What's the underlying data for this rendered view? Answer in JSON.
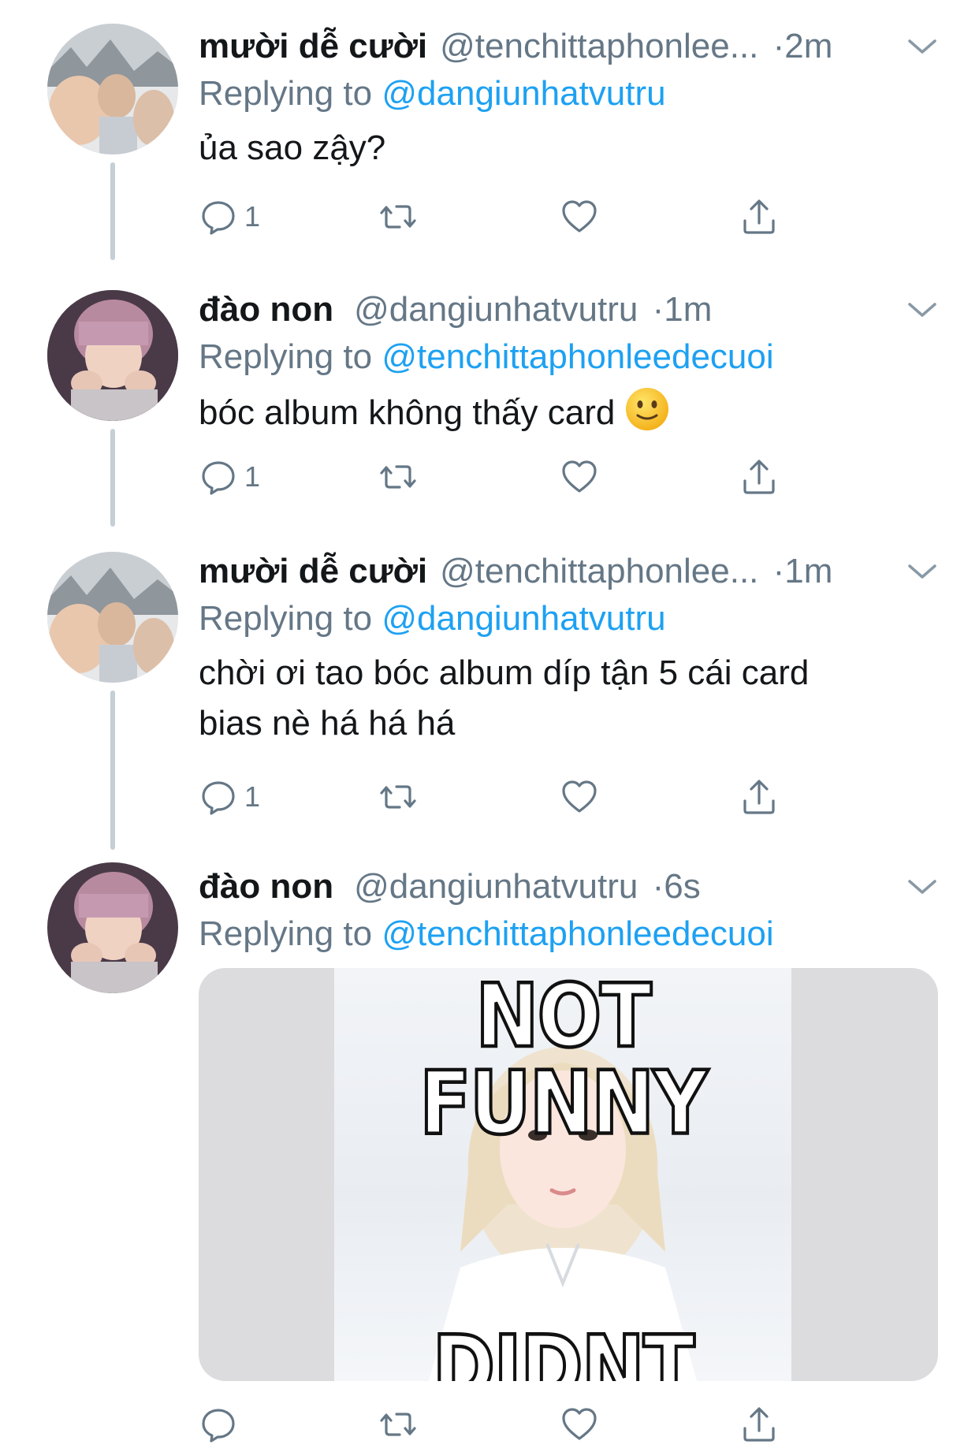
{
  "colors": {
    "link": "#1da1f2",
    "secondary": "#657786",
    "thread_line": "#c4cfd6"
  },
  "tweets": [
    {
      "display_name": "mười dễ cười",
      "handle": "@tenchittaphonlee...",
      "separator": "·",
      "time": "2m",
      "replying_prefix": "Replying to",
      "replying_to": "@dangiunhatvutru",
      "text": "ủa sao zậy?",
      "reply_count": "1"
    },
    {
      "display_name": "đào non",
      "handle": "@dangiunhatvutru",
      "separator": "·",
      "time": "1m",
      "replying_prefix": "Replying to",
      "replying_to": "@tenchittaphonleedecuoi",
      "text": "bóc album không thấy card",
      "emoji": "slightly-smiling-face",
      "reply_count": "1"
    },
    {
      "display_name": "mười dễ cười",
      "handle": "@tenchittaphonlee...",
      "separator": "·",
      "time": "1m",
      "replying_prefix": "Replying to",
      "replying_to": "@dangiunhatvutru",
      "text_line1": "chời ơi tao bóc album díp tận 5 cái card",
      "text_line2": "bias nè há há há",
      "reply_count": "1"
    },
    {
      "display_name": "đào non",
      "handle": "@dangiunhatvutru",
      "separator": "·",
      "time": "6s",
      "replying_prefix": "Replying to",
      "replying_to": "@tenchittaphonleedecuoi",
      "meme_top": "NOT FUNNY",
      "meme_bottom": "DIDNT LAUGH"
    }
  ]
}
